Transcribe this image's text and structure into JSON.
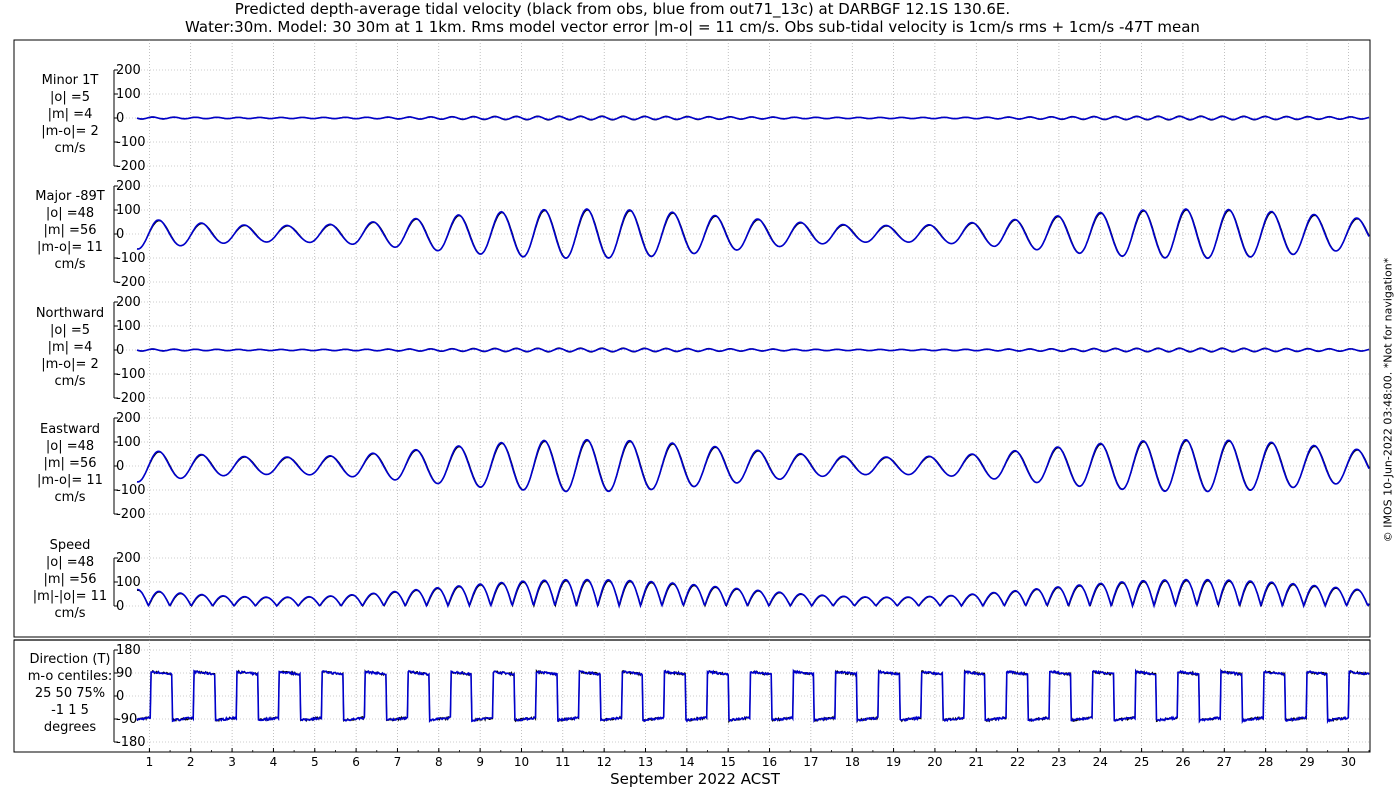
{
  "title_line1": "Predicted depth-average tidal velocity (black from obs, blue from out71_13c) at DARBGF 12.1S 130.6E.",
  "title_line2": "Water:30m. Model: 30 30m at 1 1km. Rms model vector error |m-o| = 11 cm/s. Obs sub-tidal velocity is 1cm/s rms + 1cm/s -47T mean",
  "side_note": "© IMOS 10-Jun-2022 03:48:00. *Not for navigation*",
  "colors": {
    "obs": "#000000",
    "model": "#0000cc",
    "grid": "#999999"
  },
  "chart_data": {
    "type": "line",
    "xlabel": "September 2022 ACST",
    "x_ticks": [
      "1",
      "2",
      "3",
      "4",
      "5",
      "6",
      "7",
      "8",
      "9",
      "10",
      "11",
      "12",
      "13",
      "14",
      "15",
      "16",
      "17",
      "18",
      "19",
      "20",
      "21",
      "22",
      "23",
      "24",
      "25",
      "26",
      "27",
      "28",
      "29",
      "30"
    ],
    "x_range_days": [
      0.7,
      30.5
    ],
    "grid": true,
    "series_legend": [
      {
        "name": "obs",
        "color": "#000000"
      },
      {
        "name": "out71_13c",
        "color": "#0000cc"
      }
    ],
    "panels": [
      {
        "id": "minor",
        "label_lines": [
          "Minor 1T",
          "|o| =5",
          "|m| =4",
          "|m-o|= 2",
          "cm/s"
        ],
        "yticks": [
          "200",
          "100",
          "0",
          "-100",
          "-200"
        ],
        "ylim": [
          -200,
          200
        ],
        "amplitude": 5
      },
      {
        "id": "major",
        "label_lines": [
          "Major -89T",
          "|o| =48",
          "|m| =56",
          "|m-o|= 11",
          "cm/s"
        ],
        "yticks": [
          "200",
          "100",
          "0",
          "-100",
          "-200"
        ],
        "ylim": [
          -200,
          200
        ],
        "amplitude": 100
      },
      {
        "id": "north",
        "label_lines": [
          "Northward",
          "|o| =5",
          "|m| =4",
          "|m-o|= 2",
          "cm/s"
        ],
        "yticks": [
          "200",
          "100",
          "0",
          "-100",
          "-200"
        ],
        "ylim": [
          -200,
          200
        ],
        "amplitude": 5
      },
      {
        "id": "east",
        "label_lines": [
          "Eastward",
          "|o| =48",
          "|m| =56",
          "|m-o|= 11",
          "cm/s"
        ],
        "yticks": [
          "200",
          "100",
          "0",
          "-100",
          "-200"
        ],
        "ylim": [
          -200,
          200
        ],
        "amplitude": 100
      },
      {
        "id": "speed",
        "label_lines": [
          "Speed",
          "|o| =48",
          "|m| =56",
          "|m|-|o|= 11",
          "cm/s"
        ],
        "yticks": [
          "200",
          "100",
          "0"
        ],
        "ylim": [
          0,
          200
        ],
        "amplitude": 100
      },
      {
        "id": "dir",
        "label_lines": [
          "Direction (T)",
          "m-o centiles:",
          "25  50  75%",
          "-1  1  5",
          "degrees"
        ],
        "yticks": [
          "180",
          "90",
          "0",
          "-90",
          "-180"
        ],
        "ylim": [
          -180,
          180
        ]
      }
    ]
  }
}
